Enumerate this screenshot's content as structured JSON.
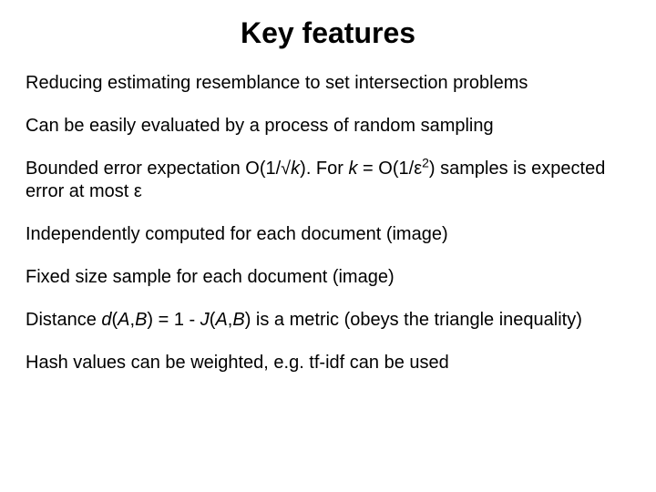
{
  "slide": {
    "title": "Key features",
    "p1": "Reducing estimating resemblance to set intersection problems",
    "p2": "Can be easily evaluated by a process of random sampling",
    "p3_a": "Bounded error expectation O(1/√",
    "p3_k1": "k",
    "p3_b": "). For ",
    "p3_k2": "k",
    "p3_c": " = O(1/ε",
    "p3_exp": "2",
    "p3_d": ") samples is expected error at most ε",
    "p4": "Independently computed for each document (image)",
    "p5": "Fixed size sample for each document (image)",
    "p6_a": "Distance ",
    "p6_d": "d",
    "p6_b": "(",
    "p6_A1": "A",
    "p6_c": ",",
    "p6_B1": "B",
    "p6_e": ") = 1 - ",
    "p6_J": "J",
    "p6_f": "(",
    "p6_A2": "A",
    "p6_g": ",",
    "p6_B2": "B",
    "p6_h": ") is a metric (obeys the triangle inequality)",
    "p7": "Hash values can be weighted, e.g. tf-idf can be used"
  }
}
